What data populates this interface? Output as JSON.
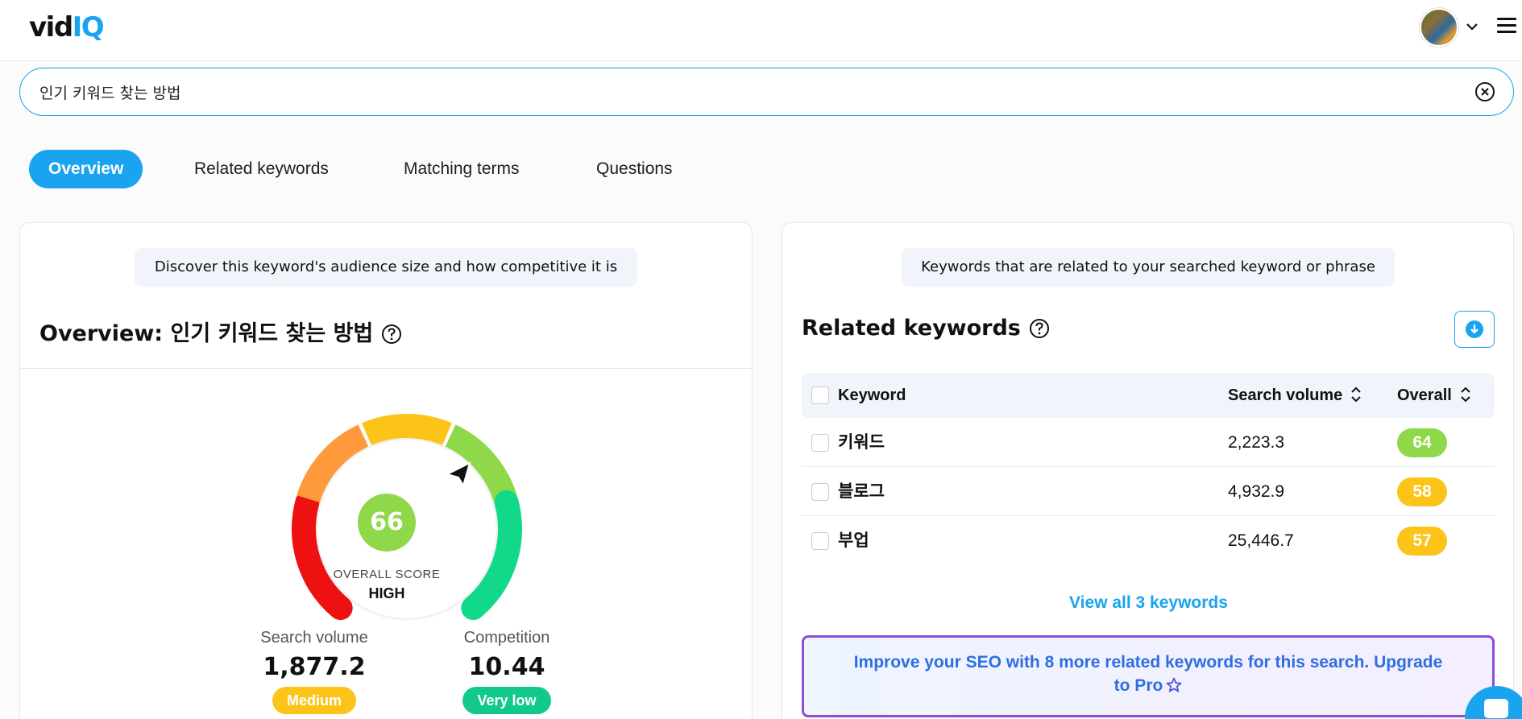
{
  "header": {
    "logo_main": "vid",
    "logo_accent": "IQ",
    "avatar_icon": "user-avatar",
    "chevron_icon": "chevron-down-icon",
    "menu_icon": "hamburger-menu-icon"
  },
  "search": {
    "value": "인기 키워드 찾는 방법",
    "clear_icon": "clear-circle-x-icon"
  },
  "tabs": [
    {
      "label": "Overview",
      "active": true
    },
    {
      "label": "Related keywords",
      "active": false
    },
    {
      "label": "Matching terms",
      "active": false
    },
    {
      "label": "Questions",
      "active": false
    }
  ],
  "overview": {
    "hint": "Discover this keyword's audience size and how competitive it is",
    "title": "Overview: 인기 키워드 찾는 방법",
    "score": "66",
    "score_label": "OVERALL SCORE",
    "score_level": "HIGH",
    "search_volume": {
      "label": "Search volume",
      "value": "1,877.2",
      "badge": "Medium",
      "badge_color": "#fcc419"
    },
    "competition": {
      "label": "Competition",
      "value": "10.44",
      "badge": "Very low",
      "badge_color": "#12c98a"
    },
    "gauge_colors": [
      "#ee1111",
      "#ff9a3c",
      "#fcc419",
      "#8ed84a",
      "#12d98a"
    ]
  },
  "related": {
    "hint": "Keywords that are related to your searched keyword or phrase",
    "title": "Related keywords",
    "download_icon": "download-arrow-icon",
    "columns": {
      "keyword": "Keyword",
      "volume": "Search volume",
      "overall": "Overall"
    },
    "rows": [
      {
        "keyword": "키워드",
        "volume": "2,223.3",
        "overall": "64",
        "color": "#8ed84a"
      },
      {
        "keyword": "블로그",
        "volume": "4,932.9",
        "overall": "58",
        "color": "#fcc419"
      },
      {
        "keyword": "부업",
        "volume": "25,446.7",
        "overall": "57",
        "color": "#fcc419"
      }
    ],
    "view_all": "View all 3 keywords",
    "upgrade_text": "Improve your SEO with 8 more related keywords for this search. Upgrade to Pro"
  },
  "colors": {
    "accent": "#1aa3ee",
    "upgrade_border": "#8a4fd6"
  }
}
